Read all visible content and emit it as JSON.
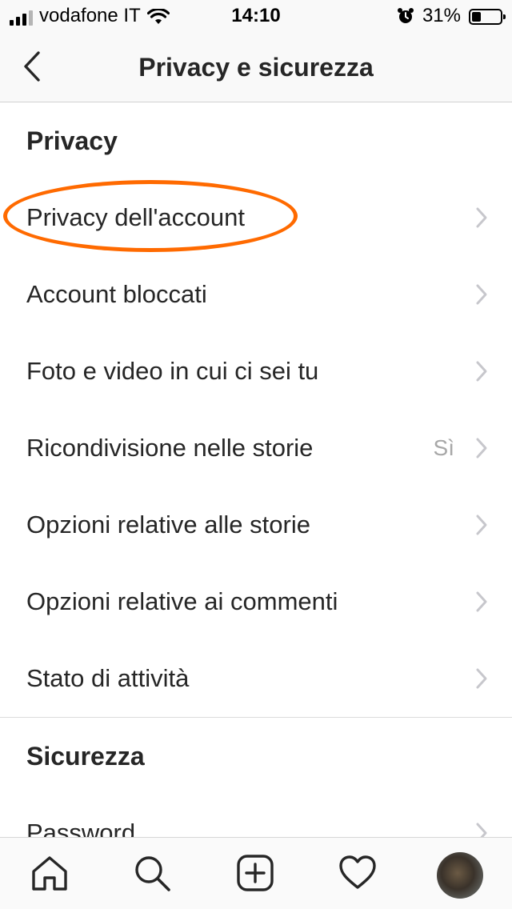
{
  "status_bar": {
    "carrier": "vodafone IT",
    "time": "14:10",
    "battery": "31%",
    "battery_level": 0.31,
    "signal_bars_active": 3,
    "signal_bars_total": 4
  },
  "nav": {
    "title": "Privacy e sicurezza"
  },
  "sections": [
    {
      "header": "Privacy",
      "items": [
        {
          "label": "Privacy dell'account",
          "value": ""
        },
        {
          "label": "Account bloccati",
          "value": ""
        },
        {
          "label": "Foto e video in cui ci sei tu",
          "value": ""
        },
        {
          "label": "Ricondivisione nelle storie",
          "value": "Sì"
        },
        {
          "label": "Opzioni relative alle storie",
          "value": ""
        },
        {
          "label": "Opzioni relative ai commenti",
          "value": ""
        },
        {
          "label": "Stato di attività",
          "value": ""
        }
      ]
    },
    {
      "header": "Sicurezza",
      "items": [
        {
          "label": "Password",
          "value": ""
        }
      ]
    }
  ],
  "colors": {
    "highlight": "#ff6a00",
    "text": "#262626",
    "secondary_text": "#a8a8a8",
    "chevron": "#c7c7cc"
  },
  "tab_bar": {
    "icons": [
      "home-icon",
      "search-icon",
      "add-post-icon",
      "activity-heart-icon",
      "profile-avatar"
    ]
  }
}
